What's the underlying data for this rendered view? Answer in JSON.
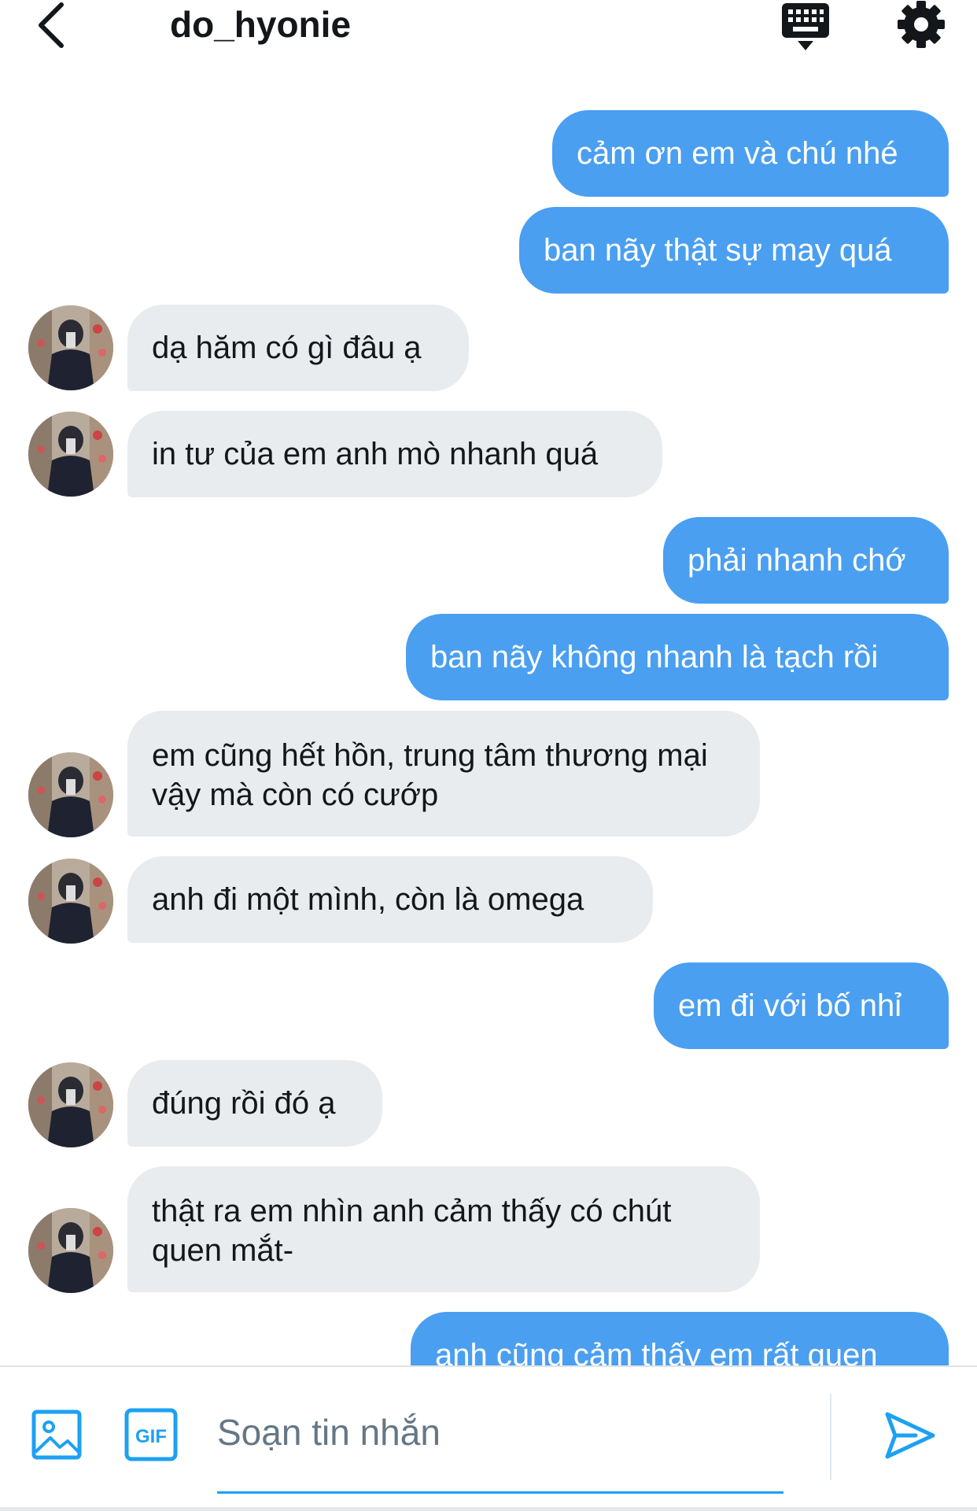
{
  "header": {
    "title": "do_hyonie"
  },
  "messages": [
    {
      "direction": "sent",
      "text": "cảm ơn em và chú nhé"
    },
    {
      "direction": "sent",
      "text": "ban nãy thật sự may quá"
    },
    {
      "direction": "received",
      "text": "dạ hăm có gì đâu ạ"
    },
    {
      "direction": "received",
      "text": "in tư của em anh mò nhanh quá"
    },
    {
      "direction": "sent",
      "text": "phải nhanh chớ"
    },
    {
      "direction": "sent",
      "text": "ban nãy không nhanh là tạch rồi"
    },
    {
      "direction": "received",
      "text": "em cũng hết hồn, trung tâm thương mại vậy mà còn có cướp"
    },
    {
      "direction": "received",
      "text": "anh đi một mình, còn là omega"
    },
    {
      "direction": "sent",
      "text": "em đi với bố nhỉ"
    },
    {
      "direction": "received",
      "text": "đúng rồi đó ạ"
    },
    {
      "direction": "received",
      "text": "thật ra em nhìn anh cảm thấy có chút quen mắt-"
    },
    {
      "direction": "sent",
      "text": "anh cũng cảm thấy em rất quen"
    }
  ],
  "composer": {
    "placeholder": "Soạn tin nhắn",
    "gif_label": "GIF"
  },
  "colors": {
    "sent_bubble": "#4a9ff0",
    "received_bubble": "#e8ecef",
    "accent": "#1da1f2"
  },
  "icons": [
    "back-arrow-icon",
    "keyboard-icon",
    "gear-icon",
    "image-icon",
    "gif-icon",
    "send-icon"
  ]
}
